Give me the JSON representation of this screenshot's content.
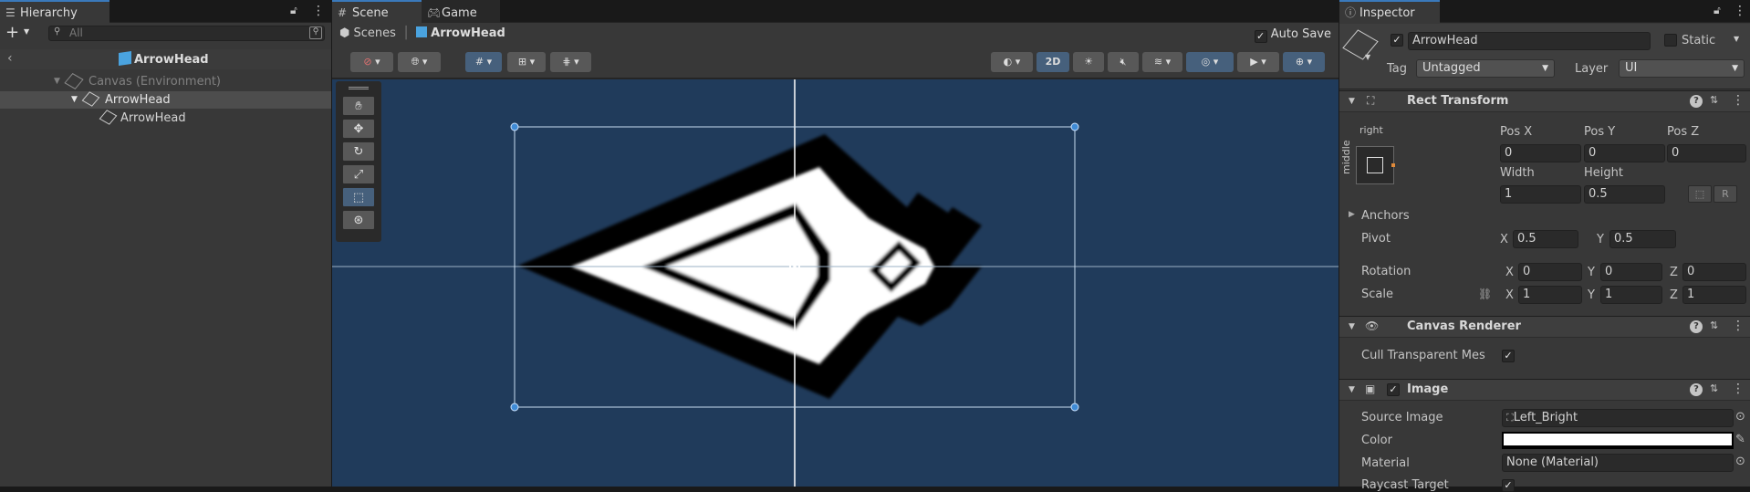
{
  "hierarchy": {
    "tab_label": "Hierarchy",
    "search_placeholder": "All",
    "scene_name": "ArrowHead",
    "items": [
      {
        "label": "Canvas (Environment)"
      },
      {
        "label": "ArrowHead"
      },
      {
        "label": "ArrowHead"
      }
    ]
  },
  "scene": {
    "tab_scene": "Scene",
    "tab_game": "Game",
    "breadcrumb_root": "Scenes",
    "breadcrumb_current": "ArrowHead",
    "auto_save_label": "Auto Save",
    "auto_save_checked": true,
    "mode_2d_label": "2D",
    "background_color": "#203b5b"
  },
  "inspector": {
    "tab_label": "Inspector",
    "object_name": "ArrowHead",
    "static_label": "Static",
    "tag_label": "Tag",
    "tag_value": "Untagged",
    "layer_label": "Layer",
    "layer_value": "UI",
    "rect_transform": {
      "title": "Rect Transform",
      "anchor_h": "right",
      "anchor_v": "middle",
      "posx_label": "Pos X",
      "posy_label": "Pos Y",
      "posz_label": "Pos Z",
      "posx": "0",
      "posy": "0",
      "posz": "0",
      "width_label": "Width",
      "height_label": "Height",
      "width": "1",
      "height": "0.5",
      "anchors_label": "Anchors",
      "pivot_label": "Pivot",
      "pivot_x_label": "X",
      "pivot_y_label": "Y",
      "pivot_x": "0.5",
      "pivot_y": "0.5",
      "rotation_label": "Rotation",
      "rot_x": "0",
      "rot_y": "0",
      "rot_z": "0",
      "scale_label": "Scale",
      "scale_x": "1",
      "scale_y": "1",
      "scale_z": "1",
      "x": "X",
      "y": "Y",
      "z": "Z"
    },
    "canvas_renderer": {
      "title": "Canvas Renderer",
      "cull_label": "Cull Transparent Mes"
    },
    "image": {
      "title": "Image",
      "source_label": "Source Image",
      "source_value": "Left_Bright",
      "color_label": "Color",
      "material_label": "Material",
      "material_value": "None (Material)",
      "raycast_label": "Raycast Target"
    }
  }
}
